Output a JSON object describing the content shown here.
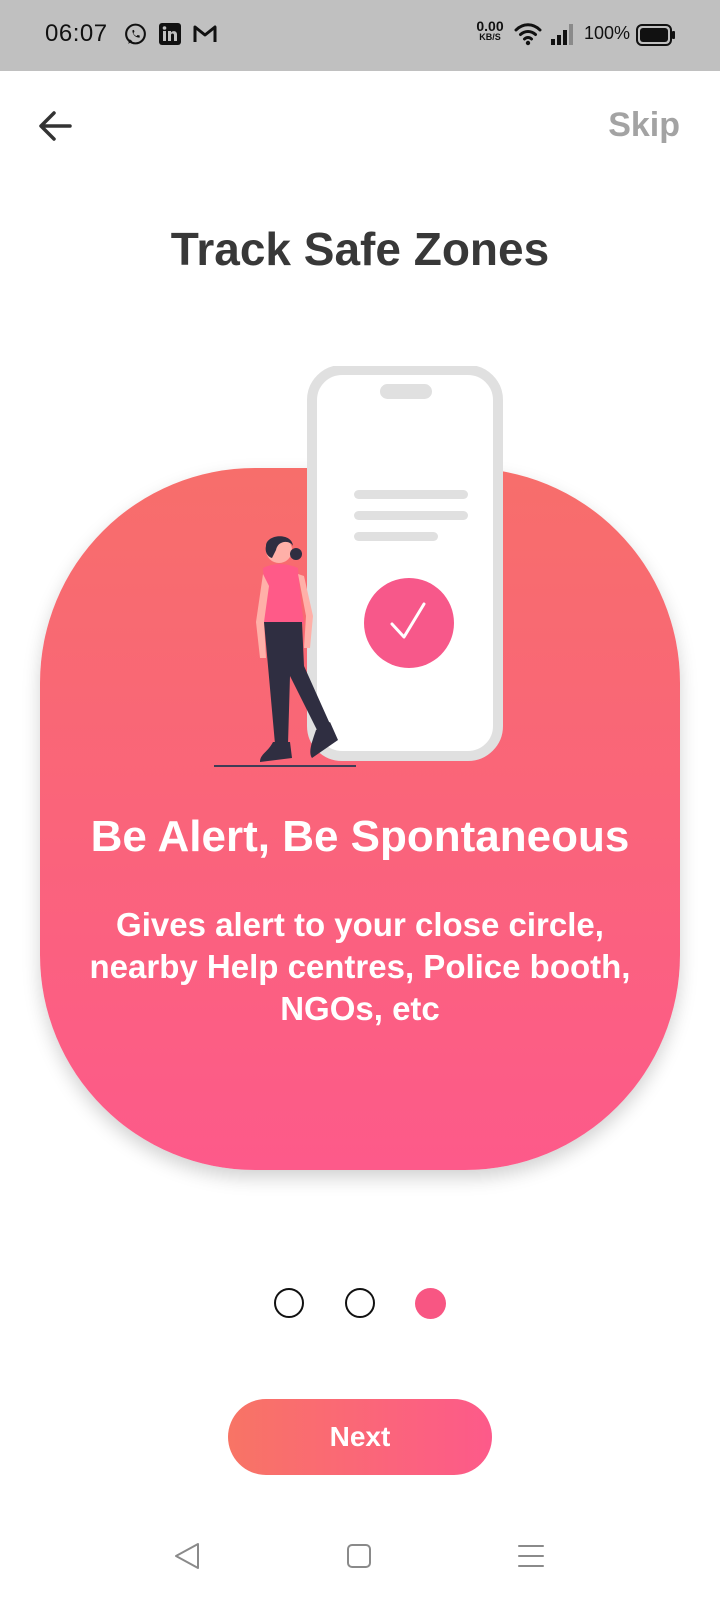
{
  "status_bar": {
    "time": "06:07",
    "notification_icons": [
      "whatsapp-icon",
      "linkedin-icon",
      "gmail-icon"
    ],
    "net_speed_value": "0.00",
    "net_speed_unit": "KB/S",
    "battery_percent": "100%"
  },
  "header": {
    "back_icon": "arrow-left-icon",
    "skip_label": "Skip"
  },
  "page_title": "Track Safe Zones",
  "card": {
    "heading": "Be Alert, Be Spontaneous",
    "body": "Gives alert to your close circle, nearby Help centres, Police booth, NGOs, etc"
  },
  "pager": {
    "total": 3,
    "active_index": 2
  },
  "next_label": "Next",
  "nav_bar": [
    "back-triangle-icon",
    "home-square-icon",
    "menu-lines-icon"
  ],
  "colors": {
    "accent": "#fd5a8a",
    "accent_start": "#f76e6b",
    "title_text": "#383838",
    "skip_text": "#a3a3a3",
    "status_bar_bg": "#c0c0c0"
  }
}
